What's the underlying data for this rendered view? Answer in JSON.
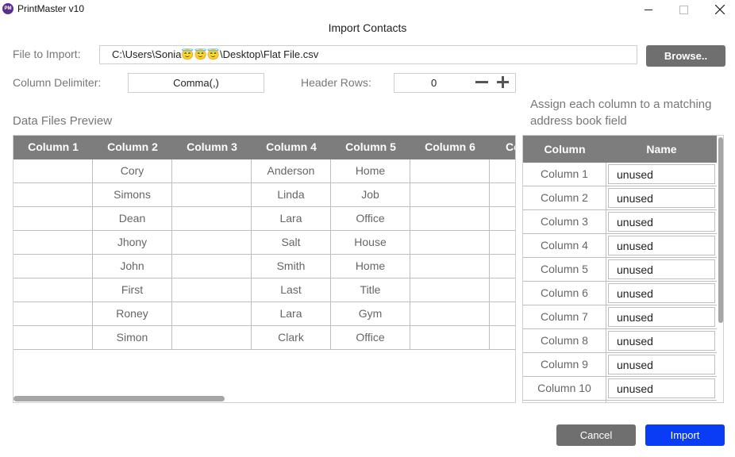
{
  "window": {
    "logo_text": "PM",
    "title": "PrintMaster v10",
    "controls": {
      "minimize": "minimize-icon",
      "maximize": "maximize-icon",
      "close": "close-icon"
    }
  },
  "dialog": {
    "title": "Import Contacts",
    "file_label": "File to Import:",
    "file_path": "C:\\Users\\Sonia😇😇😇\\Desktop\\Flat File.csv",
    "browse_label": "Browse..",
    "delimiter_label": "Column Delimiter:",
    "delimiter_value": "Comma(,)",
    "header_rows_label": "Header Rows:",
    "header_rows_value": "0",
    "preview_label": "Data Files Preview",
    "assign_label_line1": "Assign each column to a matching",
    "assign_label_line2": "address book field",
    "cancel_label": "Cancel",
    "import_label": "Import"
  },
  "preview": {
    "headers": [
      "Column 1",
      "Column 2",
      "Column 3",
      "Column 4",
      "Column 5",
      "Column 6",
      "Co"
    ],
    "rows": [
      [
        "",
        "Cory",
        "",
        "Anderson",
        "Home",
        "",
        ""
      ],
      [
        "",
        "Simons",
        "",
        "Linda",
        "Job",
        "",
        ""
      ],
      [
        "",
        "Dean",
        "",
        "Lara",
        "Office",
        "",
        ""
      ],
      [
        "",
        "Jhony",
        "",
        "Salt",
        "House",
        "",
        ""
      ],
      [
        "",
        "John",
        "",
        "Smith",
        "Home",
        "",
        ""
      ],
      [
        "",
        "First",
        "",
        "Last",
        "Title",
        "",
        ""
      ],
      [
        "",
        "Roney",
        "",
        "Lara",
        "Gym",
        "",
        ""
      ],
      [
        "",
        "Simon",
        "",
        "Clark",
        "Office",
        "",
        ""
      ]
    ]
  },
  "assign": {
    "header_column": "Column",
    "header_name": "Name",
    "rows": [
      {
        "column": "Column 1",
        "name": "unused"
      },
      {
        "column": "Column 2",
        "name": "unused"
      },
      {
        "column": "Column 3",
        "name": "unused"
      },
      {
        "column": "Column 4",
        "name": "unused"
      },
      {
        "column": "Column 5",
        "name": "unused"
      },
      {
        "column": "Column 6",
        "name": "unused"
      },
      {
        "column": "Column 7",
        "name": "unused"
      },
      {
        "column": "Column 8",
        "name": "unused"
      },
      {
        "column": "Column 9",
        "name": "unused"
      },
      {
        "column": "Column 10",
        "name": "unused"
      },
      {
        "column": "",
        "name": ""
      }
    ]
  },
  "colors": {
    "header_gray": "#7d7d7d",
    "button_gray": "#6f6f6f",
    "button_blue": "#0a3cf5",
    "logo_purple": "#5b2d8c"
  }
}
